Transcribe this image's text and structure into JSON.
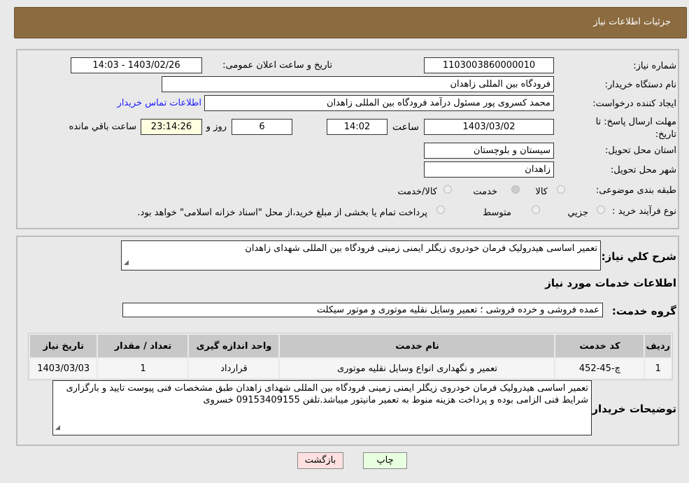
{
  "header": {
    "title": "جزئیات اطلاعات نیاز"
  },
  "form": {
    "need_number_label": "شماره نیاز:",
    "need_number": "1103003860000010",
    "announce_label": "تاریخ و ساعت اعلان عمومی:",
    "announce_value": "1403/02/26 - 14:03",
    "buyer_label": "نام دستگاه خریدار:",
    "buyer": "فرودگاه بین المللی زاهدان",
    "creator_label": "ایجاد کننده درخواست:",
    "creator": "محمد کسروی پور مسئول درآمد فرودگاه بین المللی زاهدان",
    "contact_link": "اطلاعات تماس خریدار",
    "deadline_label": "مهلت ارسال پاسخ: تا تاریخ:",
    "deadline_date": "1403/03/02",
    "time_label": "ساعت",
    "deadline_time": "14:02",
    "days": "6",
    "days_label": "روز و",
    "remaining": "23:14:26",
    "remaining_label": "ساعت باقي مانده",
    "province_label": "استان محل تحویل:",
    "province": "سیستان و بلوچستان",
    "city_label": "شهر محل تحویل:",
    "city": "زاهدان",
    "category_label": "طبقه بندی موضوعی:",
    "category_options": [
      "کالا",
      "خدمت",
      "کالا/خدمت"
    ],
    "category_selected": "خدمت",
    "process_label": "نوع فرآیند خرید :",
    "process_options": [
      "جزیي",
      "متوسط"
    ],
    "process_note": "پرداخت تمام یا بخشی از مبلغ خرید،از محل \"اسناد خزانه اسلامی\" خواهد بود."
  },
  "details": {
    "summary_label": "شرح کلي نیاز:",
    "summary": "تعمیر اساسی هیدرولیک فرمان خودروی زیگلر ایمنی زمینی فرودگاه بین المللی شهدای زاهدان",
    "services_title": "اطلاعات خدمات مورد نیاز",
    "group_label": "گروه خدمت:",
    "group": "عمده فروشی و خرده فروشی ؛ تعمیر وسایل نقلیه موتوری و موتور سیکلت",
    "table": {
      "headers": [
        "ردیف",
        "کد خدمت",
        "نام خدمت",
        "واحد اندازه گیری",
        "تعداد / مقدار",
        "تاریخ نیاز"
      ],
      "rows": [
        [
          "1",
          "چ-45-452",
          "تعمیر و نگهداری انواع وسایل نقلیه موتوری",
          "قرارداد",
          "1",
          "1403/03/03"
        ]
      ]
    },
    "buyer_notes_label": "توضیحات خریدار:",
    "buyer_notes": "تعمیر اساسی هیدرولیک فرمان خودروی زیگلر ایمنی زمینی فرودگاه بین المللی شهدای زاهدان طبق مشخصات فنی پیوست  تایید و بارگزاری شرایط فنی الزامی بوده و پرداخت هزینه منوط به تعمیر مانیتور میباشد.تلفن 09153409155 خسروی"
  },
  "buttons": {
    "back": "بازگشت",
    "print": "چاپ"
  },
  "colors": {
    "header": "#8b6b3f",
    "back_button": "#ffe0e0",
    "print_button": "#e8ffe0",
    "link": "#1a1aff"
  }
}
